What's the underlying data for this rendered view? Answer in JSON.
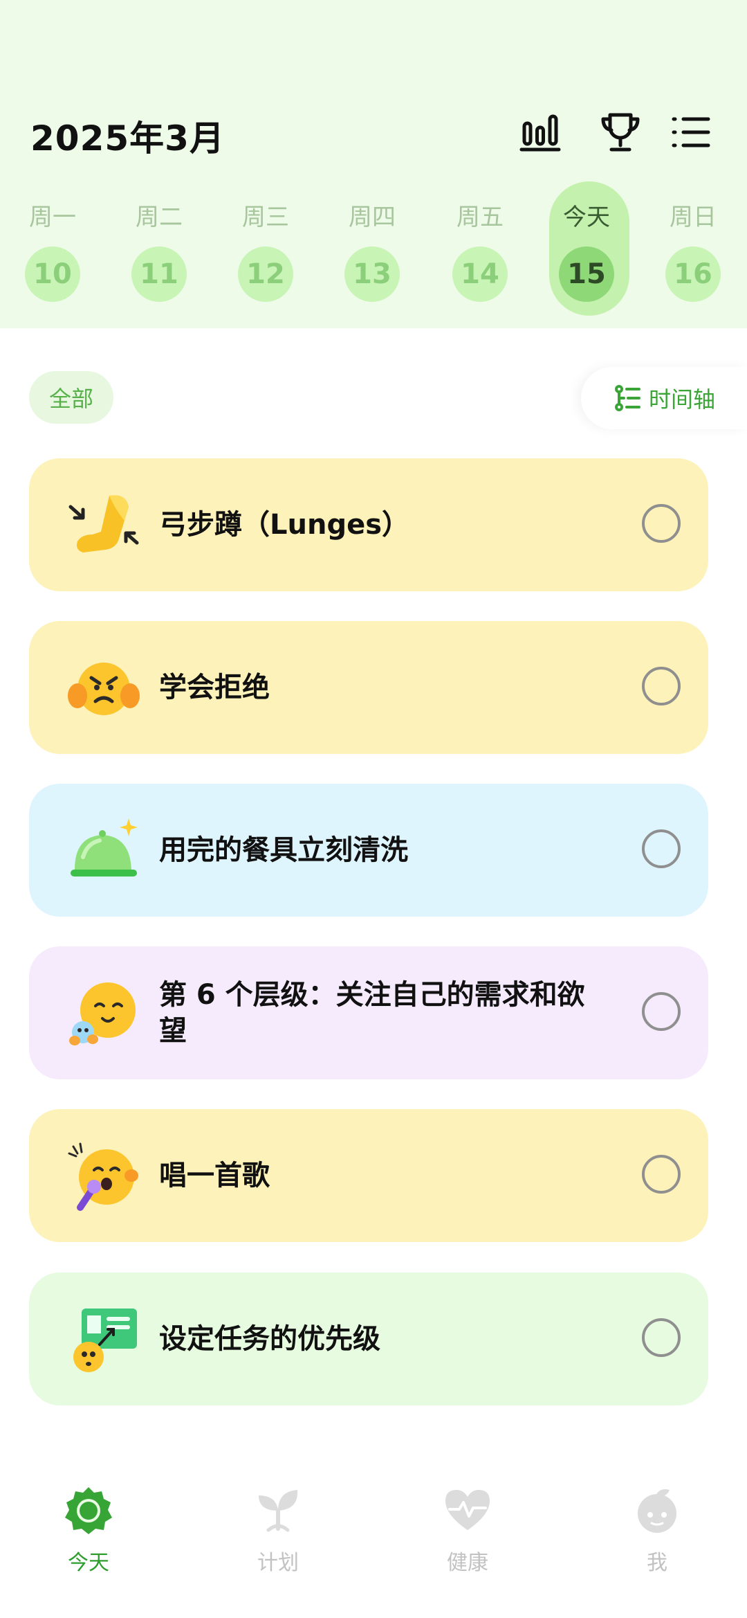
{
  "header": {
    "month_title": "2025年3月"
  },
  "week": [
    {
      "label": "周一",
      "num": "10"
    },
    {
      "label": "周二",
      "num": "11"
    },
    {
      "label": "周三",
      "num": "12"
    },
    {
      "label": "周四",
      "num": "13"
    },
    {
      "label": "周五",
      "num": "14"
    },
    {
      "label": "今天",
      "num": "15",
      "selected": true
    },
    {
      "label": "周日",
      "num": "16"
    }
  ],
  "filter": {
    "chip_label": "全部",
    "timeline_label": "时间轴"
  },
  "tasks": [
    {
      "title": "弓步蹲（Lunges）",
      "bg": "#fdf2b9",
      "icon": "flexed-leg-icon",
      "done": false
    },
    {
      "title": "学会拒绝",
      "bg": "#fdf2b9",
      "icon": "angry-refuse-face-icon",
      "done": false
    },
    {
      "title": "用完的餐具立刻清洗",
      "bg": "#dff5fd",
      "icon": "clean-dish-cover-icon",
      "done": false
    },
    {
      "title": "第 6 个层级：关注自己的需求和欲望",
      "bg": "#f6ebfc",
      "icon": "hugging-face-icon",
      "done": false
    },
    {
      "title": "唱一首歌",
      "bg": "#fdf2b9",
      "icon": "singing-face-icon",
      "done": false
    },
    {
      "title": "设定任务的优先级",
      "bg": "#e6fbdf",
      "icon": "planning-board-icon",
      "done": false
    }
  ],
  "tabs": [
    {
      "label": "今天",
      "active": true
    },
    {
      "label": "计划"
    },
    {
      "label": "健康"
    },
    {
      "label": "我"
    }
  ],
  "colors": {
    "accent": "#2f9e2f",
    "header_bg": "#effbe9"
  }
}
